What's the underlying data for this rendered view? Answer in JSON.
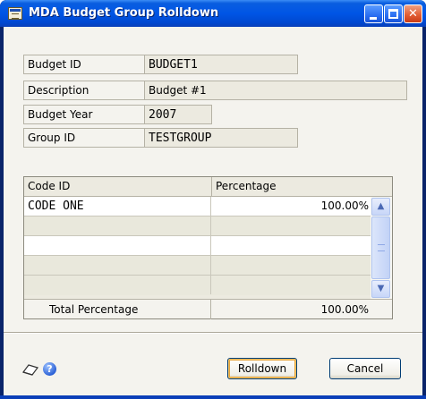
{
  "window": {
    "title": "MDA Budget Group Rolldown",
    "minimize_label": "",
    "maximize_label": "",
    "close_label": "✕"
  },
  "form": {
    "budget_id": {
      "label": "Budget ID",
      "value": "BUDGET1"
    },
    "description": {
      "label": "Description",
      "value": "Budget #1"
    },
    "budget_year": {
      "label": "Budget Year",
      "value": "2007"
    },
    "group_id": {
      "label": "Group ID",
      "value": "TESTGROUP"
    }
  },
  "grid": {
    "columns": [
      "Code ID",
      "Percentage"
    ],
    "rows": [
      {
        "code_id": "CODE ONE",
        "percentage": "100.00%"
      },
      {
        "code_id": "",
        "percentage": ""
      },
      {
        "code_id": "",
        "percentage": ""
      },
      {
        "code_id": "",
        "percentage": ""
      },
      {
        "code_id": "",
        "percentage": ""
      }
    ],
    "total_label": "Total Percentage",
    "total_value": "100.00%"
  },
  "footer": {
    "rolldown_label": "Rolldown",
    "cancel_label": "Cancel",
    "icons": [
      "note-icon",
      "help-icon"
    ]
  },
  "colors": {
    "titlebar": "#0055e5",
    "window_bg": "#f4f3ee",
    "field_bg": "#eceae0",
    "accent": "#003c74"
  }
}
